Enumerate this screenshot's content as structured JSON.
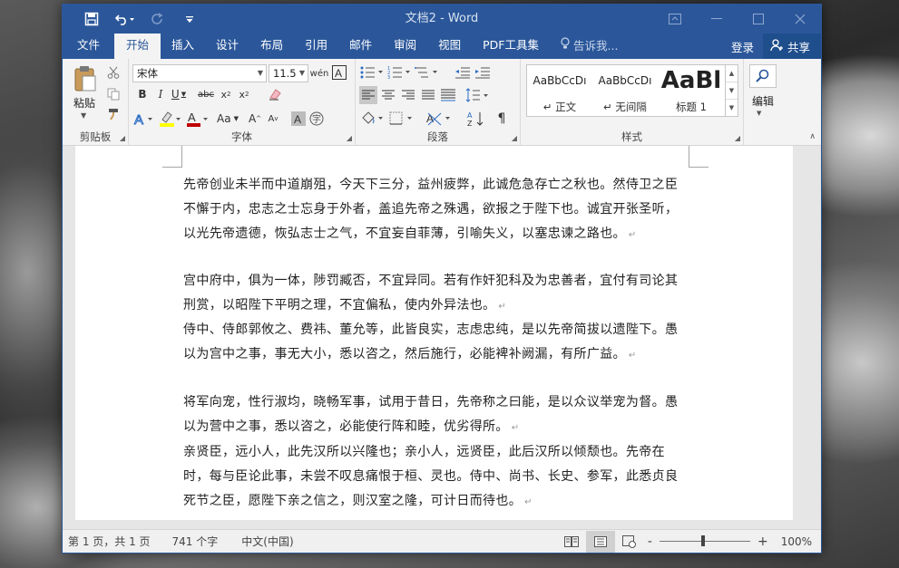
{
  "window": {
    "title": "文档2 - Word"
  },
  "tabs": [
    {
      "label": "文件"
    },
    {
      "label": "开始"
    },
    {
      "label": "插入"
    },
    {
      "label": "设计"
    },
    {
      "label": "布局"
    },
    {
      "label": "引用"
    },
    {
      "label": "邮件"
    },
    {
      "label": "审阅"
    },
    {
      "label": "视图"
    },
    {
      "label": "PDF工具集"
    }
  ],
  "tell_me": "告诉我...",
  "signin": "登录",
  "share": "共享",
  "ribbon": {
    "clipboard": {
      "paste_label": "粘贴",
      "group_label": "剪贴板"
    },
    "font": {
      "font_name": "宋体",
      "font_size": "11.5",
      "group_label": "字体"
    },
    "paragraph": {
      "group_label": "段落"
    },
    "styles": {
      "group_label": "样式",
      "items": [
        {
          "sample": "AaBbCcDı",
          "name": "正文"
        },
        {
          "sample": "AaBbCcDı",
          "name": "无间隔"
        },
        {
          "sample": "AaBl",
          "name": "标题 1"
        }
      ]
    },
    "editing": {
      "label": "编辑"
    }
  },
  "document": {
    "paragraphs": [
      "先帝创业未半而中道崩殂，今天下三分，益州疲弊，此诚危急存亡之秋也。然侍卫之臣不懈于内，忠志之士忘身于外者，盖追先帝之殊遇，欲报之于陛下也。诚宜开张圣听，以光先帝遗德，恢弘志士之气，不宜妄自菲薄，引喻失义，以塞忠谏之路也。",
      "宫中府中，俱为一体，陟罚臧否，不宜异同。若有作奸犯科及为忠善者，宜付有司论其刑赏，以昭陛下平明之理，不宜偏私，使内外异法也。",
      "侍中、侍郎郭攸之、费祎、董允等，此皆良实，志虑忠纯，是以先帝简拔以遗陛下。愚以为宫中之事，事无大小，悉以咨之，然后施行，必能裨补阙漏，有所广益。",
      "将军向宠，性行淑均，晓畅军事，试用于昔日，先帝称之曰能，是以众议举宠为督。愚以为营中之事，悉以咨之，必能使行阵和睦，优劣得所。",
      "亲贤臣，远小人，此先汉所以兴隆也；亲小人，远贤臣，此后汉所以倾颓也。先帝在时，每与臣论此事，未尝不叹息痛恨于桓、灵也。侍中、尚书、长史、参军，此悉贞良死节之臣，愿陛下亲之信之，则汉室之隆，可计日而待也。"
    ],
    "paragraph_mark": "↵"
  },
  "status": {
    "page": "第 1 页，共 1 页",
    "words": "741 个字",
    "language": "中文(中国)",
    "zoom": "100%",
    "zoom_minus": "-",
    "zoom_plus": "+"
  },
  "colors": {
    "accent": "#2b579a",
    "ribbon_bg": "#f3f3f3"
  }
}
